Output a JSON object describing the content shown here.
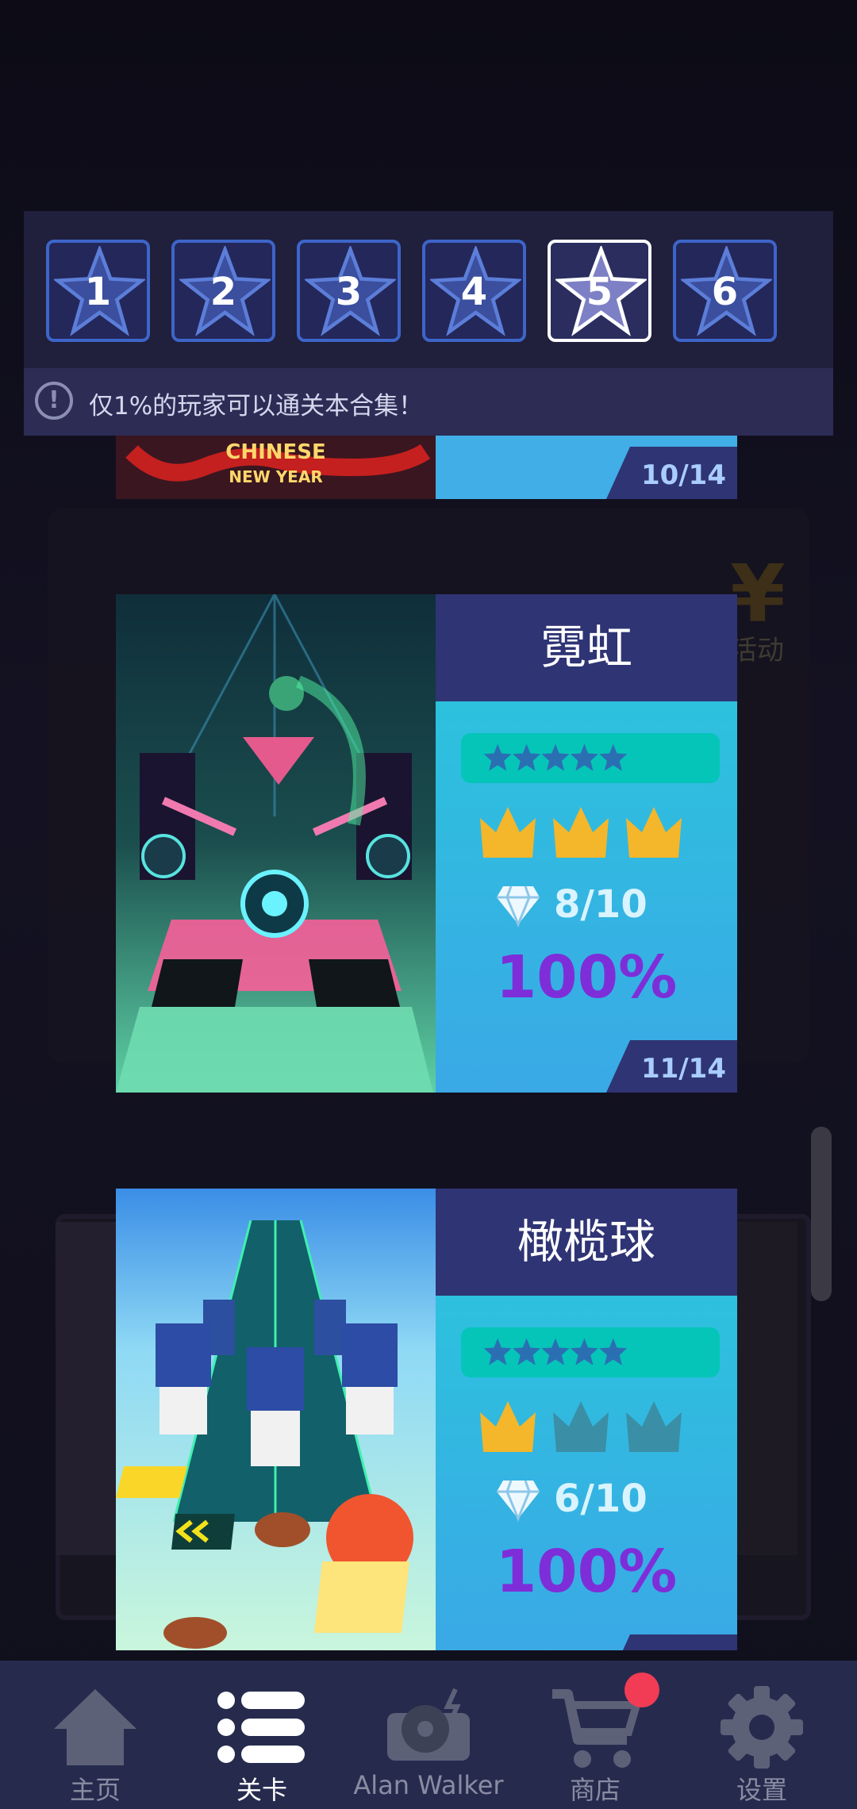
{
  "levels_tabs": [
    {
      "number": "1",
      "active": false
    },
    {
      "number": "2",
      "active": false
    },
    {
      "number": "3",
      "active": false
    },
    {
      "number": "4",
      "active": false
    },
    {
      "number": "5",
      "active": true
    },
    {
      "number": "6",
      "active": false
    }
  ],
  "notice": {
    "icon": "exclamation-icon",
    "text": "仅1%的玩家可以通关本合集！"
  },
  "background": {
    "side_text": "活动",
    "side_sign": "¥"
  },
  "partial_card": {
    "image_text_line1": "CHINESE",
    "image_text_line2": "NEW YEAR",
    "count": "10/14"
  },
  "cards": [
    {
      "title": "霓虹",
      "stars": 5,
      "crowns_earned": 3,
      "crowns_total": 3,
      "gems": "8/10",
      "percent": "100%",
      "count": "11/14"
    },
    {
      "title": "橄榄球",
      "stars": 5,
      "crowns_earned": 1,
      "crowns_total": 3,
      "gems": "6/10",
      "percent": "100%",
      "count": ""
    }
  ],
  "bottom_nav": [
    {
      "label": "主页",
      "icon": "home-icon",
      "active": false
    },
    {
      "label": "关卡",
      "icon": "list-icon",
      "active": true
    },
    {
      "label": "Alan Walker",
      "icon": "record-player-icon",
      "active": false
    },
    {
      "label": "商店",
      "icon": "cart-icon",
      "active": false,
      "badge": true
    },
    {
      "label": "设置",
      "icon": "gear-icon",
      "active": false
    }
  ],
  "colors": {
    "header_bg": "#201f3c",
    "tab_border": "#3d65c9",
    "card_title_bg": "#2f3474",
    "percent": "#7e2ed9",
    "crown_gold": "#f4b62a",
    "crown_dim": "#3a8fa6",
    "badge": "#f23c55"
  }
}
